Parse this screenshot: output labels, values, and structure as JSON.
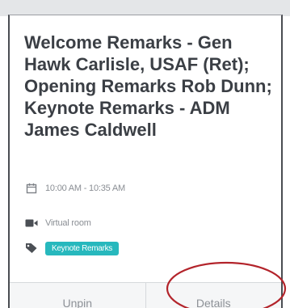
{
  "session": {
    "title": "Welcome Remarks - Gen Hawk Carlisle, USAF (Ret); Opening Remarks Rob Dunn; Keynote Remarks - ADM James Caldwell",
    "time": "10:00 AM - 10:35 AM",
    "time_icon": "calendar-icon",
    "location": "Virtual room",
    "location_icon": "video-camera-icon",
    "tag_icon": "tag-icon",
    "tag": "Keynote Remarks",
    "tag_color": "#27b8bd"
  },
  "actions": {
    "unpin_label": "Unpin",
    "details_label": "Details"
  },
  "annotation": {
    "highlight_color": "#b3242b"
  }
}
